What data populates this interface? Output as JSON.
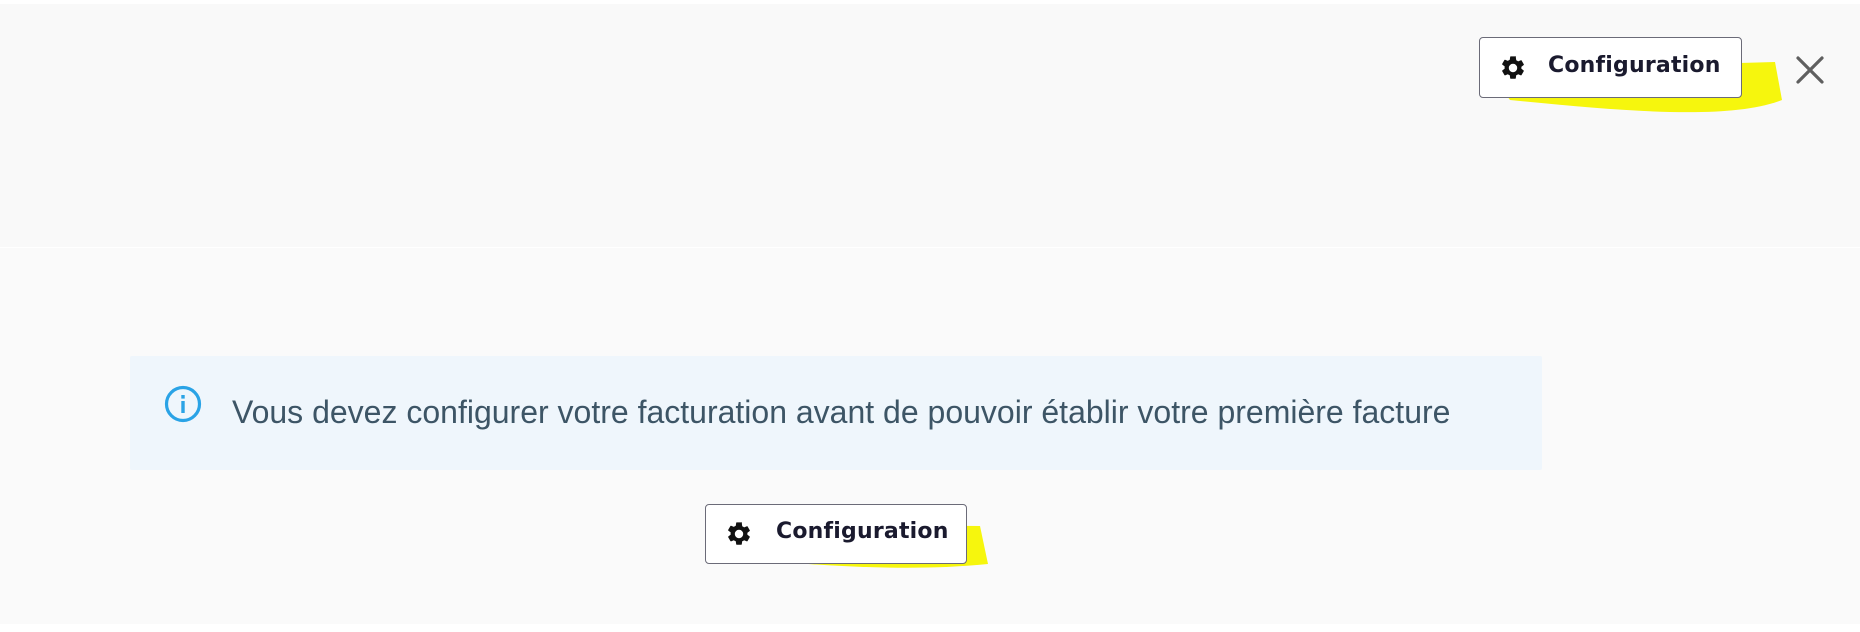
{
  "header": {
    "configuration_button_label": "Configuration",
    "close_icon": "close-icon"
  },
  "info_banner": {
    "icon": "info-icon",
    "message": "Vous devez configurer votre facturation avant de pouvoir établir votre première facture"
  },
  "main": {
    "configuration_button_label": "Configuration"
  },
  "colors": {
    "highlight": "#f5f500",
    "banner_bg": "#eff6fc",
    "info_icon": "#2aa3e6",
    "text": "#3d5566"
  }
}
